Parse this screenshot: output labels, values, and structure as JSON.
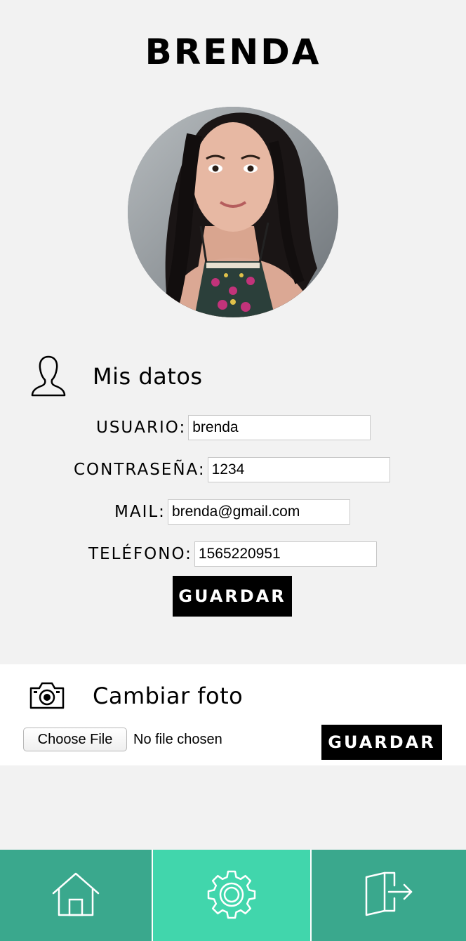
{
  "header": {
    "user_name": "BRENDA"
  },
  "profile_photo": {
    "alt": "Foto de perfil"
  },
  "datos_section": {
    "icon": "user-icon",
    "title": "Mis datos",
    "fields": {
      "usuario": {
        "label": "USUARIO:",
        "value": "brenda"
      },
      "contrasena": {
        "label": "CONTRASEÑA:",
        "value": "1234"
      },
      "mail": {
        "label": "MAIL:",
        "value": "brenda@gmail.com"
      },
      "telefono": {
        "label": "TELÉFONO:",
        "value": "1565220951"
      }
    },
    "save_label": "GUARDAR"
  },
  "foto_section": {
    "icon": "camera-icon",
    "title": "Cambiar foto",
    "choose_file_label": "Choose File",
    "file_status": "No file chosen",
    "save_label": "GUARDAR"
  },
  "bottom_nav": {
    "items": [
      {
        "icon": "home-icon",
        "active": false
      },
      {
        "icon": "gear-icon",
        "active": true
      },
      {
        "icon": "logout-icon",
        "active": false
      }
    ],
    "colors": {
      "base": "#3aa88d",
      "active": "#41d6ac"
    }
  }
}
